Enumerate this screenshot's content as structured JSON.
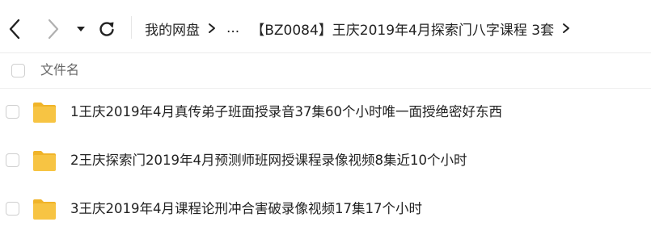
{
  "toolbar": {
    "back_icon": "chevron-left-icon",
    "forward_icon": "chevron-right-icon",
    "dropdown_icon": "caret-down-icon",
    "refresh_icon": "refresh-icon"
  },
  "breadcrumb": {
    "root": "我的网盘",
    "ellipsis": "...",
    "current": "【BZ0084】王庆2019年4月探索门八字课程 3套"
  },
  "list_header": {
    "name_column": "文件名"
  },
  "files": [
    {
      "name": "1王庆2019年4月真传弟子班面授录音37集60个小时唯一面授绝密好东西",
      "type": "folder"
    },
    {
      "name": "2王庆探索门2019年4月预测师班网授课程录像视频8集近10个小时",
      "type": "folder"
    },
    {
      "name": "3王庆2019年4月课程论刑冲合害破录像视频17集17个小时",
      "type": "folder"
    }
  ],
  "colors": {
    "folder": "#f7c443",
    "folder_tab": "#f0b429",
    "text": "#222222",
    "muted": "#666666",
    "disabled_icon": "#b0b0b0"
  }
}
